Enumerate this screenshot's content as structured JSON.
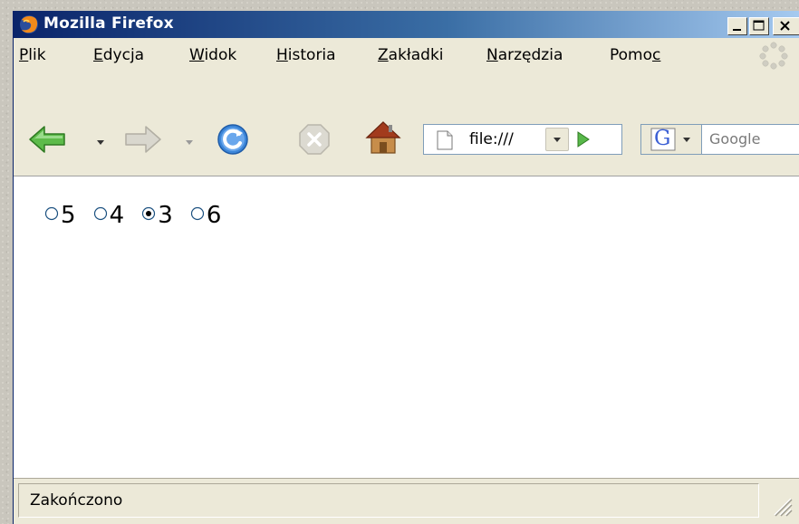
{
  "window": {
    "title": "Mozilla Firefox",
    "controls": {
      "minimize": "minimize",
      "maximize": "maximize",
      "close": "close"
    }
  },
  "menu": [
    {
      "prefix": "",
      "accel": "P",
      "rest": "lik"
    },
    {
      "prefix": "",
      "accel": "E",
      "rest": "dycja"
    },
    {
      "prefix": "",
      "accel": "W",
      "rest": "idok"
    },
    {
      "prefix": "",
      "accel": "H",
      "rest": "istoria"
    },
    {
      "prefix": "",
      "accel": "Z",
      "rest": "akładki"
    },
    {
      "prefix": "",
      "accel": "N",
      "rest": "arzędzia"
    },
    {
      "prefix": "Pomo",
      "accel": "c",
      "rest": ""
    }
  ],
  "toolbar": {
    "back": "back-arrow-icon",
    "forward": "forward-arrow-icon",
    "reload": "reload-icon",
    "stop": "stop-icon",
    "home": "home-icon",
    "address_value": "file:///",
    "go": "go-arrow-icon",
    "search_engine_label": "G",
    "search_placeholder": "Google"
  },
  "content": {
    "radio_options": [
      {
        "label": "5",
        "checked": false
      },
      {
        "label": "4",
        "checked": false
      },
      {
        "label": "3",
        "checked": true
      },
      {
        "label": "6",
        "checked": false
      }
    ]
  },
  "status": {
    "text": "Zakończono"
  },
  "colors": {
    "titlebar_dark": "#0a246a",
    "titlebar_light": "#a6caf0",
    "chrome": "#ece9d8",
    "content_bg": "#ffffff",
    "nav_green": "#5dbb4a"
  }
}
